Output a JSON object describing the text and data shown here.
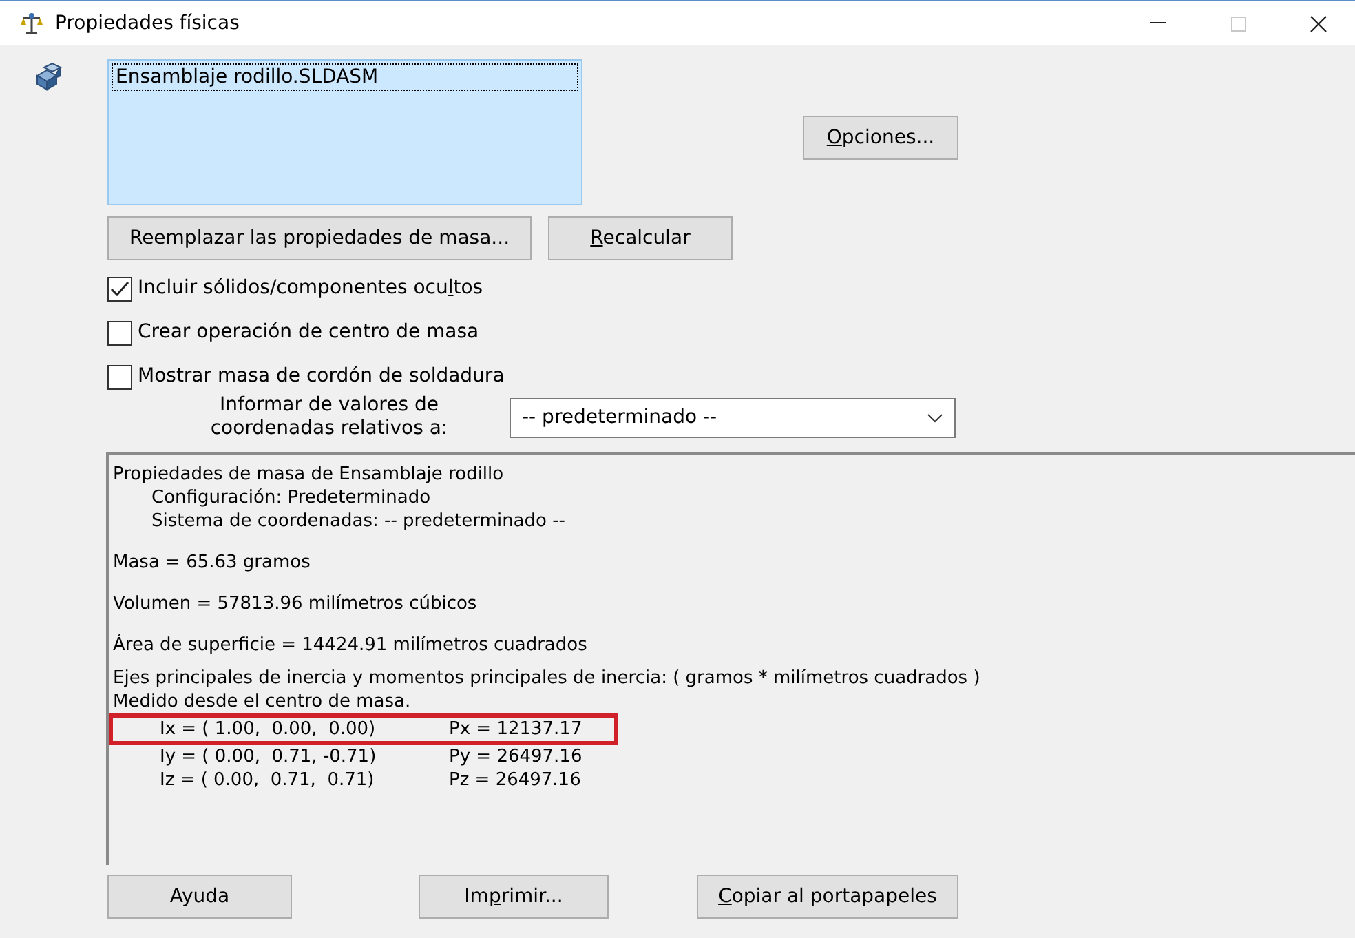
{
  "window": {
    "title": "Propiedades físicas"
  },
  "title_controls": [
    {
      "kind": "minimize"
    },
    {
      "kind": "maximize",
      "disabled": true
    },
    {
      "kind": "close"
    }
  ],
  "components": {
    "items": [
      {
        "label": "Ensamblaje rodillo.SLDASM",
        "selected": true
      }
    ]
  },
  "options_button": {
    "key": "O",
    "after": "pciones..."
  },
  "action_buttons": [
    {
      "before": "Reemplazar las propiedades de masa..."
    },
    {
      "key": "R",
      "after": "ecalcular"
    }
  ],
  "checkboxes": [
    {
      "before": "Incluir sólidos/componentes ocu",
      "key": "l",
      "after": "tos",
      "checked": true
    },
    {
      "before": "Crear operación de centro de masa",
      "checked": false
    },
    {
      "before": "Mostrar masa de cordón de soldadura",
      "checked": false
    }
  ],
  "coordinates": {
    "label": [
      "Informar de valores de",
      "coordenadas relativos a:"
    ],
    "value": "-- predeterminado --"
  },
  "results": {
    "header": "Propiedades de masa de Ensamblaje rodillo",
    "details": [
      "Configuración:  Predeterminado",
      "Sistema de coordenadas:  -- predeterminado --"
    ],
    "mass": "Masa = 65.63 gramos",
    "volume": "Volumen = 57813.96 milímetros cúbicos",
    "area": "Área de superficie = 14424.91  milímetros cuadrados",
    "inertia_title": "Ejes principales de inercia y momentos principales de inercia: ( gramos *  milímetros cuadrados )",
    "inertia_note": "Medido desde el centro de masa.",
    "inertia_rows": [
      {
        "axis": "Ix = ( 1.00,  0.00,  0.00)",
        "moment": "Px = 12137.17",
        "highlighted": true
      },
      {
        "axis": "Iy = ( 0.00,  0.71, -0.71)",
        "moment": "Py = 26497.16",
        "highlighted": false
      },
      {
        "axis": "Iz = ( 0.00,  0.71,  0.71)",
        "moment": "Pz = 26497.16",
        "highlighted": false
      }
    ]
  },
  "bottom_buttons": [
    {
      "before": "Ayuda"
    },
    {
      "before": "Im",
      "key": "p",
      "after": "rimir..."
    },
    {
      "key": "C",
      "after": "opiar al portapapeles"
    }
  ]
}
